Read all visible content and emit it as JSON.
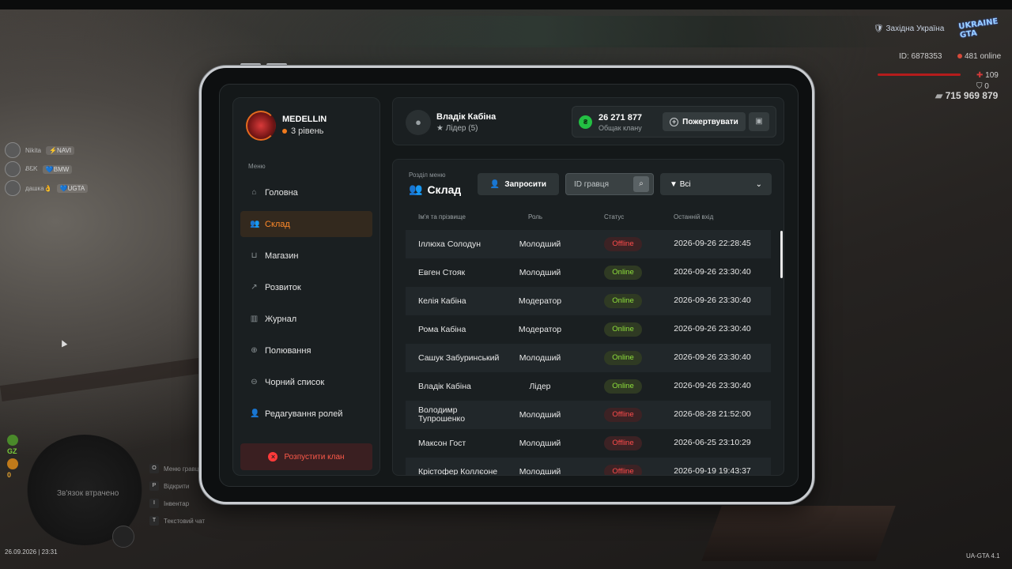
{
  "hud": {
    "region": "Західна Україна",
    "logo": "UKRAINE GTA",
    "player_id": "ID: 6878353",
    "online": "481 online",
    "health": "109",
    "armor": "0",
    "money": "715 969 879",
    "date_time": "26.09.2026 | 23:31",
    "version": "UA-GTA 4.1",
    "minimap_msg": "Зв'язок втрачено",
    "gz": "GZ",
    "zero": "0"
  },
  "players": [
    {
      "name": "Nikita",
      "tag": "⚡NAVI"
    },
    {
      "name": "ᏰᏋᏦ",
      "tag": "💙BMW"
    },
    {
      "name": "дашка👌",
      "tag": "💙UGTA"
    }
  ],
  "keys": [
    {
      "key": "O",
      "label": "Меню гравця"
    },
    {
      "key": "P",
      "label": "Відкрити"
    },
    {
      "key": "I",
      "label": "Інвентар"
    },
    {
      "key": "T",
      "label": "Текстовий чат"
    }
  ],
  "clan": {
    "name": "MEDELLIN",
    "level": "3 рівень",
    "menu_label": "Меню",
    "nav": [
      {
        "label": "Головна",
        "icon": "home-icon"
      },
      {
        "label": "Склад",
        "icon": "users-icon"
      },
      {
        "label": "Магазин",
        "icon": "basket-icon"
      },
      {
        "label": "Розвиток",
        "icon": "chart-icon"
      },
      {
        "label": "Журнал",
        "icon": "book-icon"
      },
      {
        "label": "Полювання",
        "icon": "crosshair-icon"
      },
      {
        "label": "Чорний список",
        "icon": "minus-circle-icon"
      },
      {
        "label": "Редагування ролей",
        "icon": "user-edit-icon"
      }
    ],
    "dissolve": "Розпустити клан"
  },
  "user": {
    "name": "Владік Кабіна",
    "role": "Лідер (5)"
  },
  "bank": {
    "amount": "26 271 877",
    "label": "Общак клану",
    "donate": "Пожертвувати"
  },
  "section": {
    "label": "Розділ меню",
    "title": "Склад",
    "invite": "Запросити",
    "id_placeholder": "ID гравця",
    "filter": "Всі"
  },
  "table": {
    "headers": [
      "Ім'я та прізвище",
      "Роль",
      "Статус",
      "Останній вхід"
    ],
    "rows": [
      {
        "name": "Іллюха Солодун",
        "role": "Молодший",
        "status": "Offline",
        "last": "2026-09-26 22:28:45"
      },
      {
        "name": "Евген Стояк",
        "role": "Молодший",
        "status": "Online",
        "last": "2026-09-26 23:30:40"
      },
      {
        "name": "Келія Кабіна",
        "role": "Модератор",
        "status": "Online",
        "last": "2026-09-26 23:30:40"
      },
      {
        "name": "Рома Кабіна",
        "role": "Модератор",
        "status": "Online",
        "last": "2026-09-26 23:30:40"
      },
      {
        "name": "Сашук Забуринський",
        "role": "Молодший",
        "status": "Online",
        "last": "2026-09-26 23:30:40"
      },
      {
        "name": "Владік Кабіна",
        "role": "Лідер",
        "status": "Online",
        "last": "2026-09-26 23:30:40"
      },
      {
        "name": "Володимр Тупрошенко",
        "role": "Молодший",
        "status": "Offline",
        "last": "2026-08-28 21:52:00"
      },
      {
        "name": "Максон Гост",
        "role": "Молодший",
        "status": "Offline",
        "last": "2026-06-25 23:10:29"
      },
      {
        "name": "Крістофер Коллєоне",
        "role": "Молодший",
        "status": "Offline",
        "last": "2026-09-19 19:43:37"
      }
    ]
  }
}
